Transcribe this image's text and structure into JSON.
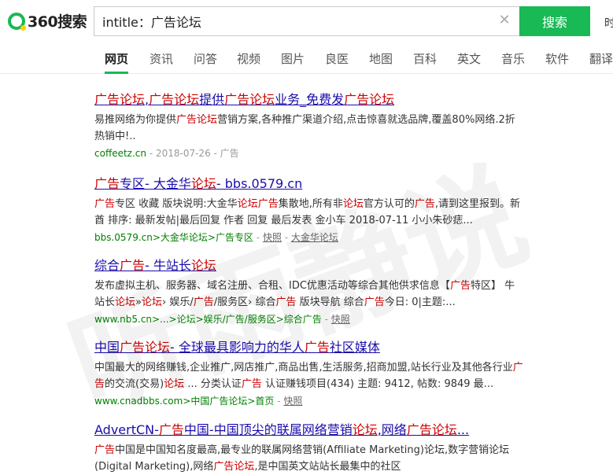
{
  "logo": {
    "text": "360搜索"
  },
  "search": {
    "value": "intitle：广告论坛",
    "button_label": "搜索"
  },
  "edge_text": "时",
  "tabs": [
    {
      "label": "网页",
      "active": true
    },
    {
      "label": "资讯"
    },
    {
      "label": "问答"
    },
    {
      "label": "视频"
    },
    {
      "label": "图片"
    },
    {
      "label": "良医"
    },
    {
      "label": "地图"
    },
    {
      "label": "百科"
    },
    {
      "label": "英文"
    },
    {
      "label": "音乐"
    },
    {
      "label": "软件"
    },
    {
      "label": "翻译"
    }
  ],
  "results": [
    {
      "title": [
        [
          "广告论坛",
          1
        ],
        [
          ",",
          0
        ],
        [
          "广告论坛",
          1
        ],
        [
          "提供",
          0
        ],
        [
          "广告论坛",
          1
        ],
        [
          "业务_免费发",
          0
        ],
        [
          "广告论坛",
          1
        ]
      ],
      "desc": [
        [
          "易推网络为你提供",
          0
        ],
        [
          "广告论坛",
          1
        ],
        [
          "营销方案,各种推广渠道介绍,点击惊喜就选品牌,覆盖80%网络.2折热销中!..",
          0
        ]
      ],
      "meta": [
        [
          "coffeetz.cn",
          0
        ],
        [
          " - 2018-07-26",
          2
        ],
        [
          " - 广告",
          2
        ]
      ]
    },
    {
      "title": [
        [
          "广告",
          1
        ],
        [
          "专区- 大金华",
          0
        ],
        [
          "论坛",
          1
        ],
        [
          "- bbs.0579.cn",
          0
        ]
      ],
      "desc": [
        [
          "广告",
          1
        ],
        [
          "专区 收藏 版块说明:大金华",
          0
        ],
        [
          "论坛",
          1
        ],
        [
          "广告",
          1
        ],
        [
          "集散地,所有非",
          0
        ],
        [
          "论坛",
          1
        ],
        [
          "官方认可的",
          0
        ],
        [
          "广告",
          1
        ],
        [
          ",请到这里报到。新酋 排序: 最新发帖|最后回复 作者 回复 最后发表 金小车 2018-07-11 小小朱砂痣...",
          0
        ]
      ],
      "meta": [
        [
          "bbs.0579.cn>大金华论坛>广告专区",
          0
        ],
        [
          " - ",
          2
        ],
        [
          "快照",
          3
        ],
        [
          " - ",
          2
        ],
        [
          "大金华论坛",
          3
        ]
      ]
    },
    {
      "title": [
        [
          "综合",
          0
        ],
        [
          "广告",
          1
        ],
        [
          "- 牛站长",
          0
        ],
        [
          "论坛",
          1
        ]
      ],
      "desc": [
        [
          "发布虚拟主机、服务器、域名注册、合租、IDC优惠活动等综合其他供求信息【",
          0
        ],
        [
          "广告",
          1
        ],
        [
          "特区】 牛站长",
          0
        ],
        [
          "论坛",
          1
        ],
        [
          "»",
          0
        ],
        [
          "论坛",
          1
        ],
        [
          "› 娱乐/",
          0
        ],
        [
          "广告",
          1
        ],
        [
          "/服务区› 综合",
          0
        ],
        [
          "广告",
          1
        ],
        [
          " 版块导航 综合",
          0
        ],
        [
          "广告",
          1
        ],
        [
          "今日: 0|主题:...",
          0
        ]
      ],
      "meta": [
        [
          "www.nb5.cn>...>论坛>娱乐/广告/服务区>综合广告",
          0
        ],
        [
          " - ",
          2
        ],
        [
          "快照",
          3
        ]
      ]
    },
    {
      "title": [
        [
          "中国",
          0
        ],
        [
          "广告论坛",
          1
        ],
        [
          "- 全球最具影响力的华人",
          0
        ],
        [
          "广告",
          1
        ],
        [
          "社区媒体",
          0
        ]
      ],
      "desc": [
        [
          "中国最大的网络赚钱,企业推广,网店推广,商品出售,生活服务,招商加盟,站长行业及其他各行业",
          0
        ],
        [
          "广告",
          1
        ],
        [
          "的交流(交易)",
          0
        ],
        [
          "论坛",
          1
        ],
        [
          " ... 分类认证",
          0
        ],
        [
          "广告",
          1
        ],
        [
          " 认证赚钱项目(434) 主题: 9412, 帖数: 9849 最...",
          0
        ]
      ],
      "meta": [
        [
          "www.cnadbbs.com>中国广告论坛>首页",
          0
        ],
        [
          " - ",
          2
        ],
        [
          "快照",
          3
        ]
      ]
    },
    {
      "title": [
        [
          "AdvertCN-",
          0
        ],
        [
          "广告",
          1
        ],
        [
          "中国-中国顶尖的联属网络营销",
          0
        ],
        [
          "论坛",
          1
        ],
        [
          ",网络",
          0
        ],
        [
          "广告论坛",
          1
        ],
        [
          "...",
          0
        ]
      ],
      "desc": [
        [
          "广告",
          1
        ],
        [
          "中国是中国知名度最高,最专业的联属网络营销(Affiliate Marketing)论坛,数字营销论坛(Digital Marketing),网络",
          0
        ],
        [
          "广告论坛",
          1
        ],
        [
          ",是中国英文站站长最集中的社区",
          0
        ]
      ],
      "meta": []
    }
  ],
  "watermark": {
    "text": "听雨静说"
  },
  "colors": {
    "accent": "#19b955",
    "link": "#1a0dab",
    "highlight": "#cc0000",
    "url": "#008000"
  }
}
